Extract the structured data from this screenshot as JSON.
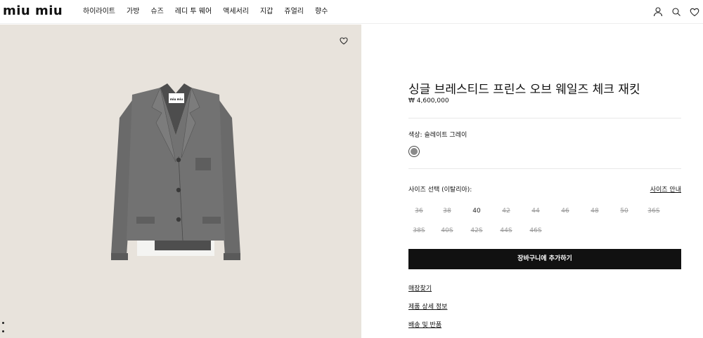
{
  "header": {
    "logo": "miu miu",
    "nav": [
      "하이라이트",
      "가방",
      "슈즈",
      "레디 투 웨어",
      "액세서리",
      "지갑",
      "쥬얼리",
      "향수"
    ],
    "icons": [
      "user-icon",
      "search-icon",
      "heart-icon"
    ]
  },
  "product": {
    "title": "싱글 브레스티드 프린스 오브 웨일즈 체크 재킷",
    "price": "₩ 4,600,000",
    "color_label": "색상: 슬레이트 그레이",
    "color_swatch": "#8a8a8a",
    "size_label": "사이즈 선택 (이탈리아):",
    "size_guide": "사이즈 안내",
    "sizes": [
      {
        "label": "36",
        "available": false
      },
      {
        "label": "38",
        "available": false
      },
      {
        "label": "40",
        "available": true
      },
      {
        "label": "42",
        "available": false
      },
      {
        "label": "44",
        "available": false
      },
      {
        "label": "46",
        "available": false
      },
      {
        "label": "48",
        "available": false
      },
      {
        "label": "50",
        "available": false
      },
      {
        "label": "36S",
        "available": false
      },
      {
        "label": "38S",
        "available": false
      },
      {
        "label": "40S",
        "available": false
      },
      {
        "label": "42S",
        "available": false
      },
      {
        "label": "44S",
        "available": false
      },
      {
        "label": "46S",
        "available": false
      }
    ],
    "add_to_cart": "장바구니에 추가하기",
    "links": [
      "매장찾기",
      "제품 상세 정보",
      "배송 및 반품"
    ]
  }
}
